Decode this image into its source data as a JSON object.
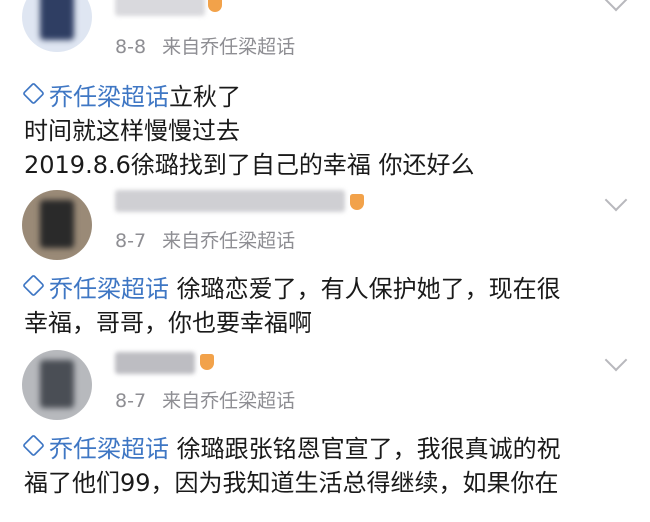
{
  "posts": [
    {
      "username": "甜ustin",
      "date": "8-8",
      "source": "来自乔任梁超话",
      "topic": "乔任梁超话",
      "lines": [
        "立秋了",
        "时间就这样慢慢过去",
        "2019.8.6徐璐找到了自己的幸福 你还好么"
      ]
    },
    {
      "username": "萌萌1202019003",
      "date": "8-7",
      "source": "来自乔任梁超话",
      "topic": "乔任梁超话",
      "lines": [
        " 徐璐恋爱了，有人保护她了，现在很",
        "幸福，哥哥，你也要幸福啊"
      ]
    },
    {
      "username": "",
      "date": "8-7",
      "source": "来自乔任梁超话",
      "topic": "乔任梁超话",
      "lines": [
        " 徐璐跟张铭恩官宣了，我很真诚的祝",
        "福了他们99，因为我知道生活总得继续，如果你在"
      ]
    }
  ],
  "colors": {
    "topic": "#3f77c4",
    "meta": "#8e8e93",
    "text": "#1a1a1a"
  },
  "icons": {
    "topic": "super-topic-icon",
    "more": "chevron-down-icon",
    "badge": "member-badge-icon"
  }
}
